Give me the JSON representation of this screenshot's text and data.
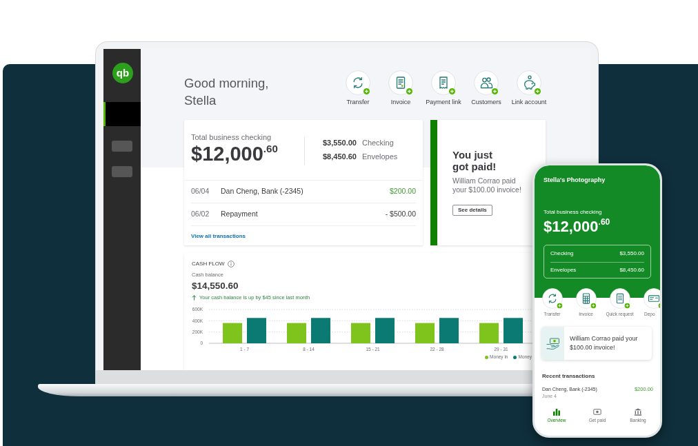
{
  "laptop": {
    "sidebar": {
      "logo": "qb",
      "items": [
        {
          "selected": true
        },
        {
          "selected": false
        },
        {
          "selected": false
        }
      ]
    },
    "greeting": "Good morning, Stella",
    "quick_actions": [
      {
        "label": "Transfer"
      },
      {
        "label": "Invoice"
      },
      {
        "label": "Payment link"
      },
      {
        "label": "Customers"
      },
      {
        "label": "Link account"
      }
    ],
    "balance_card": {
      "label": "Total business checking",
      "amount": "$12,000$^{.60}$",
      "accounts": [
        {
          "amount": "$3,550.00",
          "name": "Checking"
        },
        {
          "amount": "$8,450.60",
          "name": "Envelopes"
        }
      ],
      "transactions": [
        {
          "date": "06/04",
          "description": "Dan Cheng, Bank (-2345)",
          "amount": "$200.00",
          "kind": "credit"
        },
        {
          "date": "06/02",
          "description": "Repayment",
          "amount": "- $500.00",
          "kind": "debit"
        }
      ],
      "link": "View all transactions"
    },
    "payment_card": {
      "title": "You just got paid!",
      "message": "William Corrao paid your $100.00 invoice!",
      "button": "See details"
    },
    "cash_flow": {
      "title": "CASH FLOW",
      "balance_label": "Cash balance",
      "balance": "$14,550.60",
      "trend": "Your cash balance is up by $45 since last month",
      "chart_data": {
        "type": "bar",
        "categories": [
          "1 - 7",
          "8 - 14",
          "15 - 21",
          "22 - 28",
          "29 - 31"
        ],
        "series": [
          {
            "name": "Money in",
            "color": "#7fc41c",
            "values": [
              360000,
              360000,
              360000,
              360000,
              360000
            ]
          },
          {
            "name": "Money",
            "color": "#0b7a72",
            "values": [
              450000,
              450000,
              450000,
              450000,
              450000
            ]
          }
        ],
        "ylim": [
          0,
          600000
        ],
        "yticks": [
          {
            "value": 0,
            "label": "0"
          },
          {
            "value": 200000,
            "label": "200K"
          },
          {
            "value": 400000,
            "label": "400K"
          },
          {
            "value": 600000,
            "label": "600K"
          }
        ]
      }
    }
  },
  "phone": {
    "business_name": "Stella's Photography",
    "balance_label": "Total business checking",
    "balance": "$12,000$^{.60}$",
    "accounts": [
      {
        "name": "Checking",
        "amount": "$3,550.00"
      },
      {
        "name": "Envelopes",
        "amount": "$8,450.60"
      }
    ],
    "quick_actions": [
      {
        "label": "Transfer"
      },
      {
        "label": "Invoice"
      },
      {
        "label": "Quick request"
      },
      {
        "label": "Depo"
      }
    ],
    "notification": "William Corrao paid your $100.00 invoice!",
    "recent_title": "Recent transactions",
    "transactions": [
      {
        "description": "Dan Cheng, Bank (-2345)",
        "amount": "$200.00",
        "date": "June 4"
      }
    ],
    "nav": [
      {
        "label": "Overview",
        "selected": true
      },
      {
        "label": "Get paid",
        "selected": false
      },
      {
        "label": "Banking",
        "selected": false
      }
    ]
  }
}
